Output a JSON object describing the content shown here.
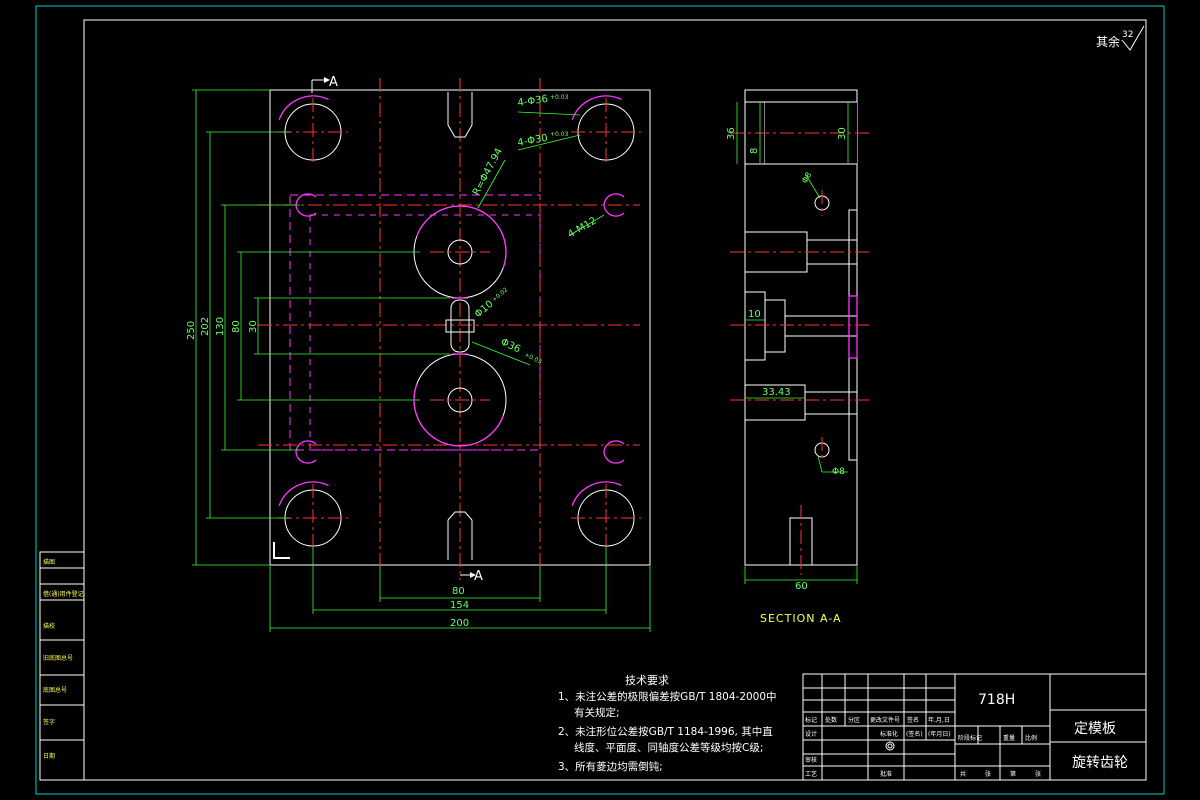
{
  "roughness": {
    "label": "其余",
    "value": "32"
  },
  "section_markers": {
    "top": "A",
    "bottom": "A"
  },
  "front_view": {
    "dims_horizontal": [
      "80",
      "154",
      "200"
    ],
    "dims_vertical": [
      "250",
      "202",
      "130",
      "80",
      "30"
    ],
    "callouts": [
      "4-Φ36",
      "4-Φ30",
      "R=Φ47.94",
      "4-M12",
      "Φ10",
      "Φ36"
    ],
    "callout_sup": [
      "+0.03",
      "+0.03",
      "+0.02",
      "+0.03"
    ]
  },
  "section_view": {
    "title": "SECTION A-A",
    "dims": [
      "36",
      "8",
      "30",
      "10",
      "33.43",
      "60",
      "Φ8",
      "Φ8"
    ]
  },
  "tech_requirements": {
    "title": "技术要求",
    "items": [
      "1、未注公差的极限偏差按GB/T 1804-2000中",
      "有关规定;",
      "2、未注形位公差按GB/T 1184-1996, 其中直",
      "线度、平面度、同轴度公差等级均按C级;",
      "3、所有菱边均需倒钝;"
    ]
  },
  "title_block": {
    "material": "718H",
    "part_name": "定模板",
    "project": "旋转齿轮",
    "row_labels": [
      "标记",
      "处数",
      "分区",
      "更改文件号",
      "签名",
      "年,月,日"
    ],
    "row2": [
      "设计",
      "标准化",
      "(签名)",
      "(年月日)"
    ],
    "stage_labels": [
      "阶段标记",
      "重量",
      "比例"
    ],
    "review": [
      "审核"
    ],
    "process": [
      "工艺",
      "批准"
    ],
    "sheet": [
      "共",
      "张",
      "第",
      "张"
    ]
  },
  "left_strip": [
    "借(通)用件登记",
    "旧底图总号",
    "签字",
    "日期",
    "底图总号",
    "描图",
    "描校"
  ],
  "colors": {
    "frame": "#00cccc",
    "object": "#ffffff",
    "center": "#ff3333",
    "hidden": "#ff33ff",
    "dimension": "#33ff33",
    "text": "#ffff55"
  }
}
